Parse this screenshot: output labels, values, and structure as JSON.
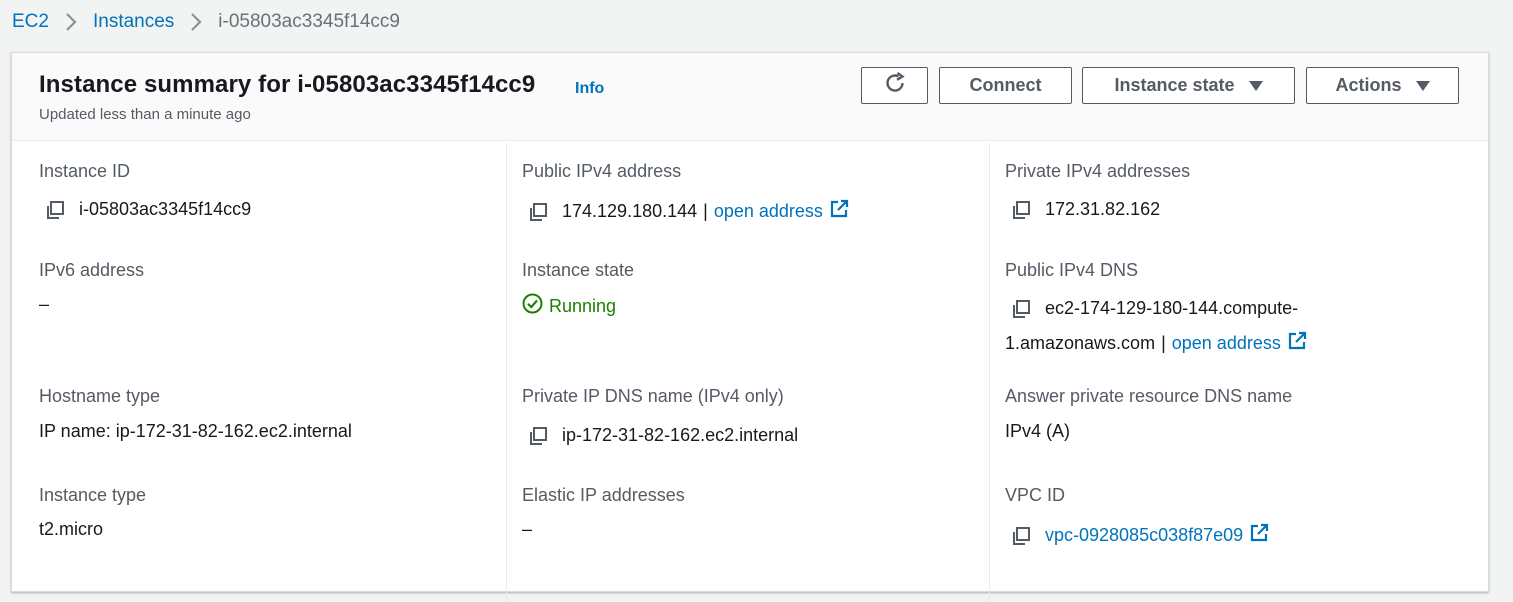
{
  "breadcrumb": {
    "items": [
      "EC2",
      "Instances"
    ],
    "current": "i-05803ac3345f14cc9"
  },
  "header": {
    "title": "Instance summary for i-05803ac3345f14cc9",
    "info": "Info",
    "subtitle": "Updated less than a minute ago",
    "buttons": {
      "connect": "Connect",
      "instance_state": "Instance state",
      "actions": "Actions"
    }
  },
  "details": {
    "instance_id": {
      "label": "Instance ID",
      "value": "i-05803ac3345f14cc9"
    },
    "public_ipv4": {
      "label": "Public IPv4 address",
      "value": "174.129.180.144",
      "separator": "|",
      "link": "open address"
    },
    "private_ipv4": {
      "label": "Private IPv4 addresses",
      "value": "172.31.82.162"
    },
    "ipv6": {
      "label": "IPv6 address",
      "value": "–"
    },
    "instance_state": {
      "label": "Instance state",
      "value": "Running"
    },
    "public_dns": {
      "label": "Public IPv4 DNS",
      "value_line1": "ec2-174-129-180-144.compute-",
      "value_line2": "1.amazonaws.com",
      "separator": "|",
      "link": "open address"
    },
    "hostname_type": {
      "label": "Hostname type",
      "value": "IP name: ip-172-31-82-162.ec2.internal"
    },
    "private_dns": {
      "label": "Private IP DNS name (IPv4 only)",
      "value": "ip-172-31-82-162.ec2.internal"
    },
    "answer_dns": {
      "label": "Answer private resource DNS name",
      "value": "IPv4 (A)"
    },
    "instance_type": {
      "label": "Instance type",
      "value": "t2.micro"
    },
    "elastic_ip": {
      "label": "Elastic IP addresses",
      "value": "–"
    },
    "vpc_id": {
      "label": "VPC ID",
      "value": "vpc-0928085c038f87e09"
    }
  },
  "colors": {
    "link": "#0073bb",
    "running": "#1d8102",
    "label": "#545b64",
    "background": "#f2f3f3"
  },
  "icons": [
    "chevron-right-icon",
    "refresh-icon",
    "caret-down-icon",
    "copy-icon",
    "external-link-icon",
    "check-circle-icon"
  ]
}
